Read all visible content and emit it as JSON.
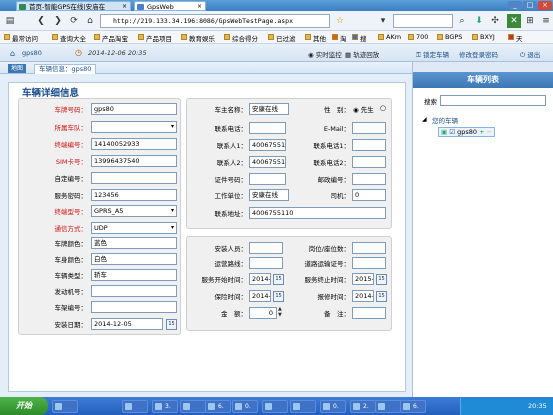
{
  "browser": {
    "tabs": [
      {
        "title": "首页-智能GPS在线|安庙在"
      },
      {
        "title": "GpsWeb"
      }
    ],
    "url": "http://219.133.34.196:8086/GpsWebTestPage.aspx",
    "bookmarks": [
      "最常访问",
      "查询大全",
      "产品淘宝",
      "产品项目",
      "教育娱乐",
      "综合得分",
      "已过滤",
      "其他",
      "淘",
      "搜",
      "AKm",
      "700",
      "BGPS",
      "BXYJ",
      "天"
    ]
  },
  "app": {
    "home_label": "gps80",
    "datetime": "2014-12-06 20:35",
    "actions": [
      "实时监控",
      "轨迹回放",
      "锁定车辆",
      "修改登录密码",
      "退出"
    ]
  },
  "crumb": {
    "badge": "地图",
    "tab": "车辆信息：gps80"
  },
  "panel": {
    "title": "车辆详细信息",
    "left_fields": [
      {
        "label": "车牌号码：",
        "value": "gps80"
      },
      {
        "label": "所属车队：",
        "value": ""
      },
      {
        "label": "终端编号：",
        "value": "14140052933"
      },
      {
        "label": "SIM卡号：",
        "value": "13996437540"
      },
      {
        "label": "自定编号：",
        "value": ""
      },
      {
        "label": "服务密码：",
        "value": "123456"
      },
      {
        "label": "终端型号：",
        "value": "GPRS_A5"
      },
      {
        "label": "通信方式：",
        "value": "UDP"
      },
      {
        "label": "车牌颜色：",
        "value": "蓝色"
      },
      {
        "label": "车身颜色：",
        "value": "白色"
      },
      {
        "label": "车辆类型：",
        "value": "轿车"
      },
      {
        "label": "发动机号：",
        "value": ""
      },
      {
        "label": "车架编号：",
        "value": ""
      },
      {
        "label": "安装日期：",
        "value": "2014-12-05"
      }
    ],
    "owner": {
      "name_label": "车主名称：",
      "name": "安康在线",
      "gender_label": "性　别：",
      "gender_male": "先生",
      "phone_label": "联系电话：",
      "phone": "",
      "email_label": "E-Mail：",
      "email": "",
      "contact1_label": "联系人1：",
      "contact1": "400675511",
      "tel1_label": "联系电话1：",
      "tel1": "",
      "contact2_label": "联系人2：",
      "contact2": "400675511",
      "tel2_label": "联系电话2：",
      "tel2": "",
      "cert_label": "证件号码：",
      "cert": "",
      "zip_label": "邮政编号：",
      "zip": "",
      "work_label": "工作单位：",
      "work": "安康在线",
      "driver_label": "司机：",
      "driver": "0",
      "addr_label": "联系地址：",
      "addr": "4006755110"
    },
    "service": {
      "installer_label": "安装人员：",
      "installer": "",
      "pos_label": "岗位/座位数：",
      "pos": "",
      "route_label": "运营路线：",
      "route": "",
      "permit_label": "道路运输证号：",
      "permit": "",
      "start_label": "服务开始时间：",
      "start": "2014-1",
      "end_label": "服务终止时间：",
      "end": "2015-(",
      "ins_label": "保险时间：",
      "ins": "2014-1",
      "repair_label": "报修时间：",
      "repair": "2014-1",
      "amount_label": "金　额：",
      "amount": "0",
      "remark_label": "备　注：",
      "remark": ""
    }
  },
  "vehicles": {
    "title": "车辆列表",
    "search_label": "搜索",
    "group": "您的车辆",
    "item": "gps80"
  },
  "taskbar": {
    "start": "开始",
    "items": [
      "",
      "",
      "3.",
      "",
      "6.",
      "0.",
      "",
      "",
      "0.",
      "2.",
      "",
      "6."
    ],
    "clock": "20:35"
  }
}
